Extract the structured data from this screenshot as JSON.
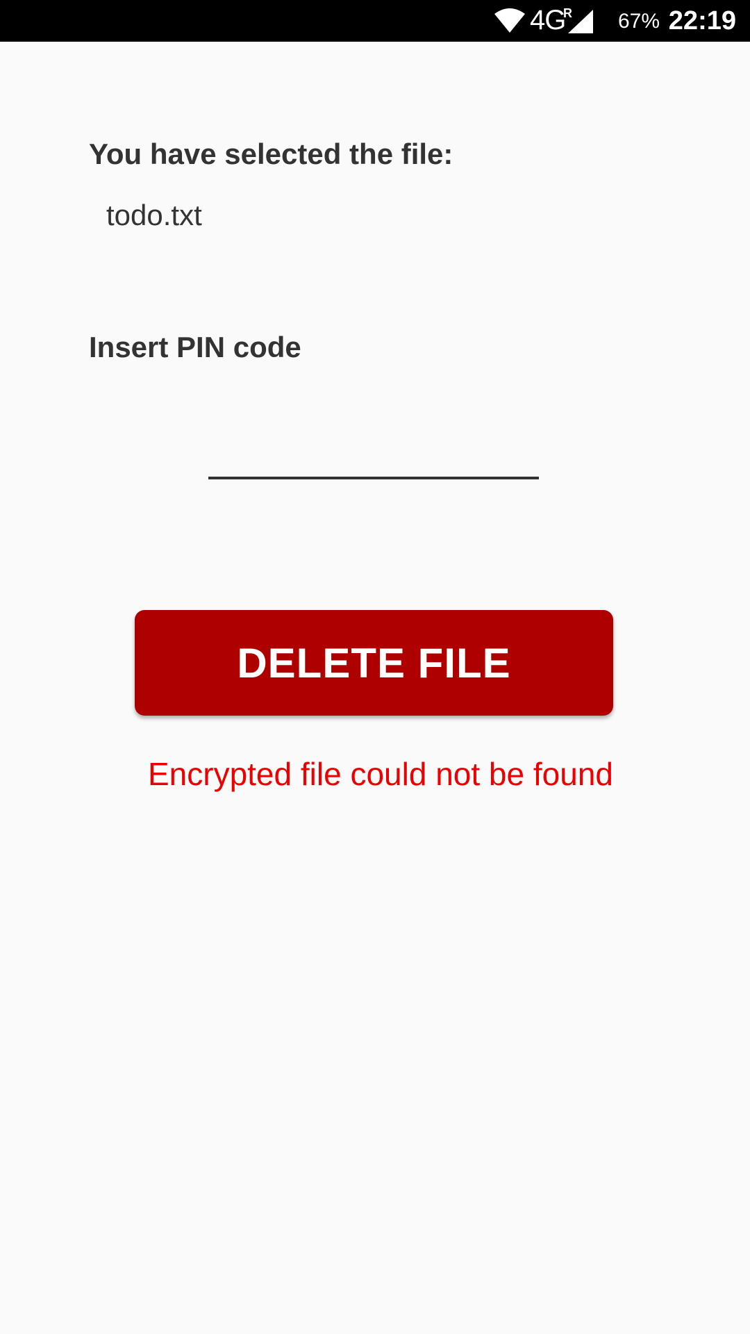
{
  "status_bar": {
    "network_type": "4G",
    "roaming_indicator": "R",
    "battery": "67%",
    "time": "22:19",
    "icons": [
      "wifi-icon",
      "signal-icon"
    ]
  },
  "main": {
    "selected_label": "You have selected the file:",
    "file_name": "todo.txt",
    "pin_label": "Insert PIN code",
    "pin_value": "",
    "delete_button_label": "DELETE FILE",
    "error_message": "Encrypted file could not be found"
  },
  "colors": {
    "background": "#fafafa",
    "text": "#333333",
    "button": "#af0000",
    "error": "#ee0000",
    "status_bar": "#000000"
  }
}
